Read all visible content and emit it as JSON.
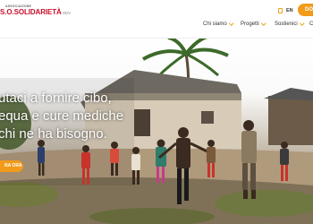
{
  "header": {
    "logo_prefix": "ASSOCIAZIONE",
    "logo_name": "S.O.SOLIDARIETÀ",
    "logo_suffix": "ODV",
    "language": "EN",
    "donate_label": "DO"
  },
  "nav": {
    "items": [
      {
        "label": "Chi siamo"
      },
      {
        "label": "Progetti"
      },
      {
        "label": "Sostienici"
      },
      {
        "label": "C"
      }
    ]
  },
  "hero": {
    "title_lines": [
      "utaci a fornire cibo,",
      "equa e cure mediche",
      "chi ne ha bisogno."
    ],
    "cta_label": "NA ORA"
  },
  "colors": {
    "accent": "#f29a1a",
    "brand": "#c8102e"
  }
}
